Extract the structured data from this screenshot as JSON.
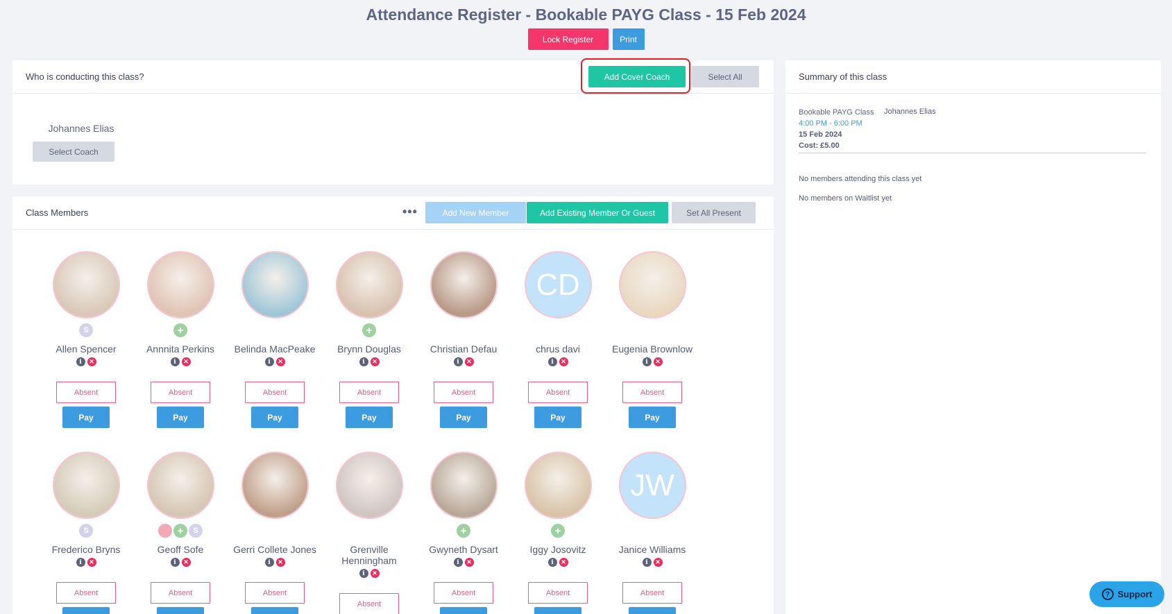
{
  "header": {
    "title": "Attendance Register - Bookable PAYG Class - 15 Feb 2024",
    "lock_label": "Lock Register",
    "print_label": "Print"
  },
  "coach_panel": {
    "title": "Who is conducting this class?",
    "add_cover_label": "Add Cover Coach",
    "select_all_label": "Select All",
    "coach_name": "Johannes Elias",
    "select_coach_label": "Select Coach"
  },
  "members_panel": {
    "title": "Class Members",
    "more_label": "•••",
    "add_new_label": "Add New Member",
    "add_existing_label": "Add Existing Member Or Guest",
    "set_all_present_label": "Set All Present",
    "absent_label": "Absent",
    "pay_label": "Pay",
    "members": [
      {
        "name": "Allen Spencer",
        "initials": "",
        "badges": [
          "S"
        ]
      },
      {
        "name": "Annnita Perkins",
        "initials": "",
        "badges": [
          "+"
        ]
      },
      {
        "name": "Belinda MacPeake",
        "initials": "",
        "badges": []
      },
      {
        "name": "Brynn Douglas",
        "initials": "",
        "badges": [
          "+"
        ]
      },
      {
        "name": "Christian Defau",
        "initials": "",
        "badges": []
      },
      {
        "name": "chrus davi",
        "initials": "CD",
        "badges": []
      },
      {
        "name": "Eugenia Brownlow",
        "initials": "",
        "badges": []
      },
      {
        "name": "Frederico Bryns",
        "initials": "",
        "badges": [
          "S"
        ]
      },
      {
        "name": "Geoff Sofe",
        "initials": "",
        "badges": [
          "bag",
          "+",
          "S"
        ]
      },
      {
        "name": "Gerri Collete Jones",
        "initials": "",
        "badges": []
      },
      {
        "name": "Grenville Henningham",
        "initials": "",
        "badges": []
      },
      {
        "name": "Gwyneth Dysart",
        "initials": "",
        "badges": [
          "+"
        ]
      },
      {
        "name": "Iggy Josovitz",
        "initials": "",
        "badges": [
          "+"
        ]
      },
      {
        "name": "Janice Williams",
        "initials": "JW",
        "badges": []
      }
    ]
  },
  "summary": {
    "title": "Summary of this class",
    "class_name": "Bookable PAYG Class",
    "time": "4:00 PM - 6:00 PM",
    "date": "15 Feb 2024",
    "cost": "Cost: £5.00",
    "coach": "Johannes Elias",
    "no_members": "No members attending this class yet",
    "no_waitlist": "No members on Waitlist yet"
  },
  "support": {
    "label": "Support",
    "icon": "?"
  },
  "colors": {
    "pink": "#f4366d",
    "blue": "#3d9be0",
    "teal": "#1fc6a6",
    "highlight": "#e41e26"
  }
}
